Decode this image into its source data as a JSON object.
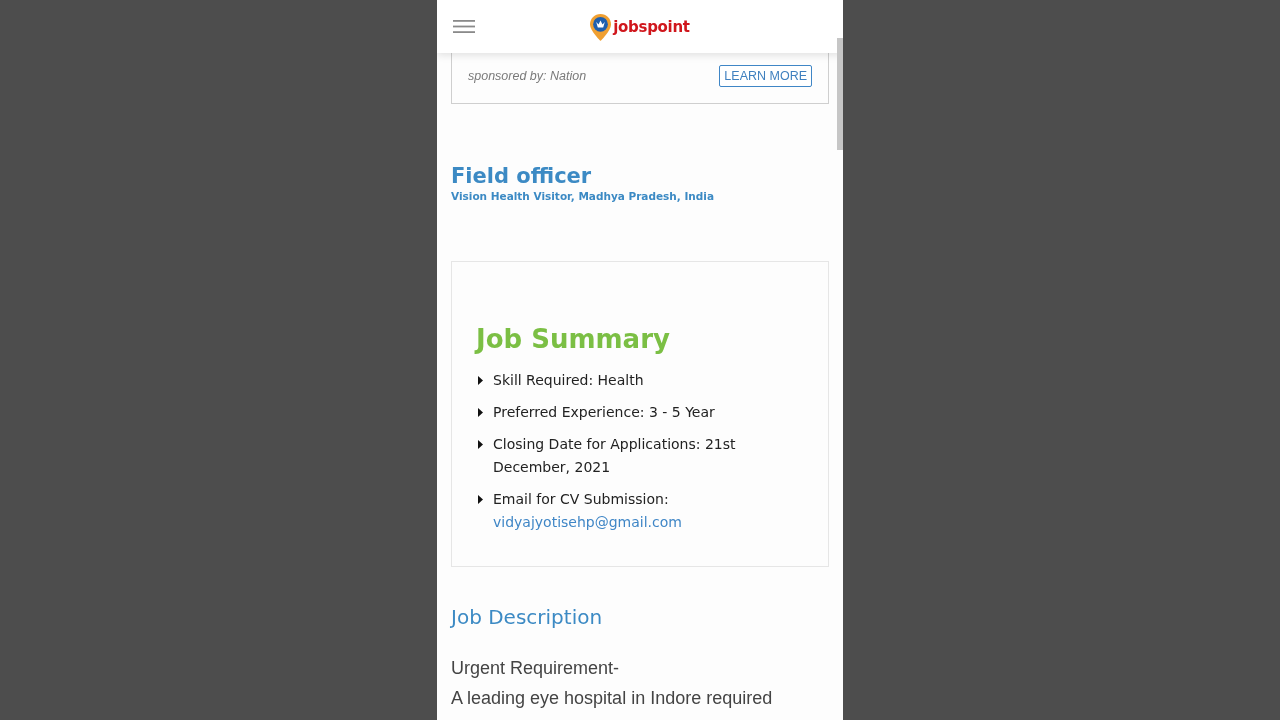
{
  "header": {
    "logo_text": "jobspoint"
  },
  "ad": {
    "sponsor": "sponsored by: Nation",
    "button": "LEARN MORE"
  },
  "job": {
    "title": "Field officer",
    "subtitle": "Vision Health Visitor, Madhya Pradesh, India"
  },
  "summary": {
    "title": "Job Summary",
    "items": [
      {
        "text": "Skill Required: Health"
      },
      {
        "text": "Preferred Experience: 3 - 5 Year"
      },
      {
        "text": "Closing Date for Applications: 21st December, 2021"
      },
      {
        "text": "Email for CV Submission:",
        "link": "vidyajyotisehp@gmail.com"
      }
    ]
  },
  "description": {
    "title": "Job Description",
    "lines": [
      "Urgent Requirement-",
      "A leading eye hospital in Indore required"
    ]
  }
}
